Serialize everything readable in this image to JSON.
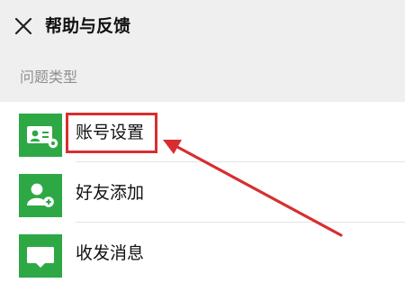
{
  "header": {
    "close_icon": "close-icon",
    "title": "帮助与反馈"
  },
  "section": {
    "label": "问题类型"
  },
  "list": {
    "items": [
      {
        "label": "账号设置",
        "icon": "id-card-gear-icon"
      },
      {
        "label": "好友添加",
        "icon": "user-add-icon"
      },
      {
        "label": "收发消息",
        "icon": "message-icon"
      }
    ]
  },
  "colors": {
    "accent_green": "#2ea845",
    "annotation_red": "#d72f30",
    "header_bg": "#efefef",
    "section_text": "#8f8f8f"
  }
}
